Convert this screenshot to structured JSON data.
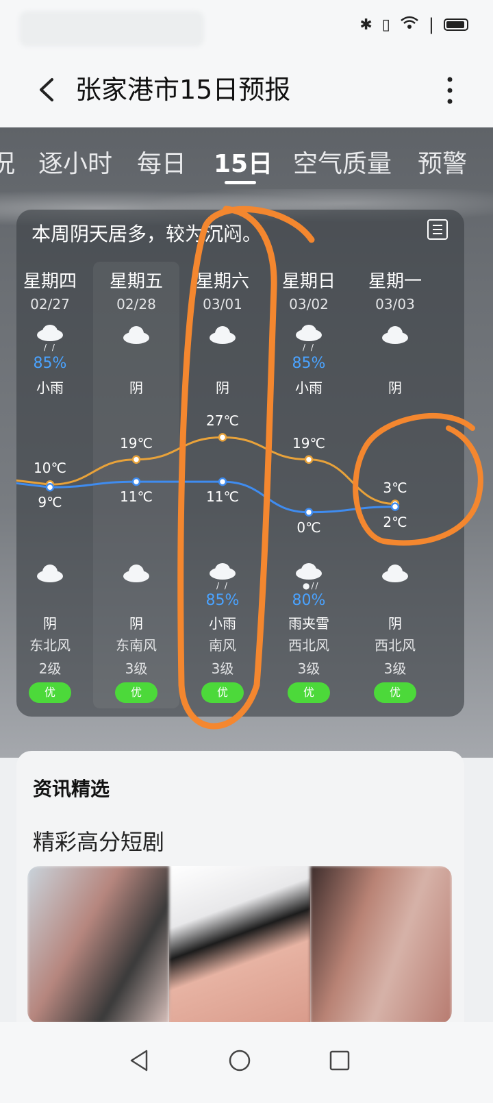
{
  "header": {
    "title": "张家港市15日预报"
  },
  "tabs": [
    {
      "label": "况"
    },
    {
      "label": "逐小时"
    },
    {
      "label": "每日"
    },
    {
      "label": "15日"
    },
    {
      "label": "空气质量"
    },
    {
      "label": "预警"
    }
  ],
  "summary": "本周阴天居多，较为沉闷。",
  "days": [
    {
      "weekday": "星期四",
      "date": "02/27",
      "day_icon": "light-rain-icon",
      "day_precip": "85%",
      "day_desc": "小雨",
      "high": "10℃",
      "low": "9℃",
      "night_icon": "cloudy-icon",
      "night_precip": "",
      "night_desc": "阴",
      "wind_dir": "东北风",
      "wind_level": "2级",
      "aqi": "优"
    },
    {
      "weekday": "星期五",
      "date": "02/28",
      "day_icon": "cloudy-icon",
      "day_precip": "",
      "day_desc": "阴",
      "high": "19℃",
      "low": "11℃",
      "night_icon": "cloudy-icon",
      "night_precip": "",
      "night_desc": "阴",
      "wind_dir": "东南风",
      "wind_level": "3级",
      "aqi": "优"
    },
    {
      "weekday": "星期六",
      "date": "03/01",
      "day_icon": "cloudy-icon",
      "day_precip": "",
      "day_desc": "阴",
      "high": "27℃",
      "low": "11℃",
      "night_icon": "light-rain-icon",
      "night_precip": "85%",
      "night_desc": "小雨",
      "wind_dir": "南风",
      "wind_level": "3级",
      "aqi": "优"
    },
    {
      "weekday": "星期日",
      "date": "03/02",
      "day_icon": "light-rain-icon",
      "day_precip": "85%",
      "day_desc": "小雨",
      "high": "19℃",
      "low": "0℃",
      "night_icon": "sleet-icon",
      "night_precip": "80%",
      "night_desc": "雨夹雪",
      "wind_dir": "西北风",
      "wind_level": "3级",
      "aqi": "优"
    },
    {
      "weekday": "星期一",
      "date": "03/03",
      "day_icon": "cloudy-icon",
      "day_precip": "",
      "day_desc": "阴",
      "high": "3℃",
      "low": "2℃",
      "night_icon": "cloudy-icon",
      "night_precip": "",
      "night_desc": "阴",
      "wind_dir": "西北风",
      "wind_level": "3级",
      "aqi": "优"
    }
  ],
  "chart_data": {
    "type": "line",
    "x": [
      "02/27",
      "02/28",
      "03/01",
      "03/02",
      "03/03"
    ],
    "series": [
      {
        "values": [
          10,
          19,
          27,
          19,
          3
        ],
        "color": "#e8a23a"
      },
      {
        "values": [
          9,
          11,
          11,
          0,
          2
        ],
        "color": "#3f8cf0"
      }
    ],
    "ylim": [
      -7,
      35
    ]
  },
  "news": {
    "title": "资讯精选",
    "subtitle": "精彩高分短剧"
  },
  "colors": {
    "aqi_good": "#4cd93a",
    "precip_blue": "#4aa3ff",
    "annotation_orange": "#f4872f"
  }
}
